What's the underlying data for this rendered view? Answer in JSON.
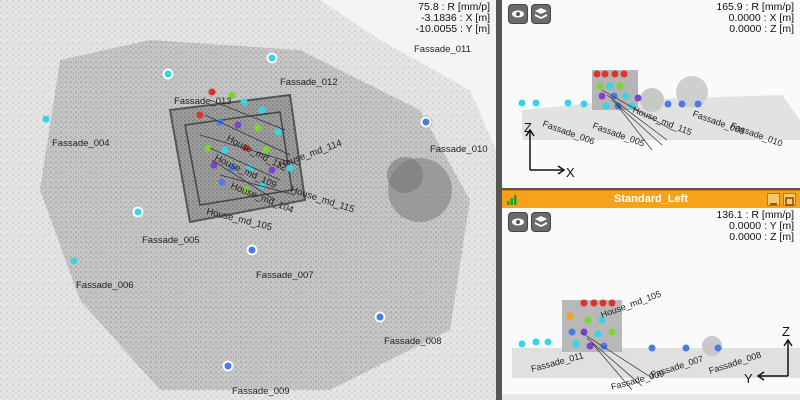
{
  "main_view": {
    "readout": [
      "75.8 : R [mm/p]",
      "-3.1836 : X [m]",
      "-10.0055 : Y [m]"
    ],
    "labels": [
      "Fassade_011",
      "Fassade_012",
      "Fassade_013",
      "Fassade_004",
      "Fassade_010",
      "Fassade_005",
      "Fassade_006",
      "Fassade_007",
      "Fassade_008",
      "Fassade_009",
      "House_md_112",
      "House_md_114",
      "House_md_115",
      "House_md_105",
      "House_md_104",
      "House_md_109"
    ]
  },
  "front_view": {
    "readout": [
      "165.9 : R [mm/p]",
      "0.0000 : X [m]",
      "0.0000 : Z [m]"
    ],
    "axis_vertical": "Z",
    "axis_horizontal": "X",
    "labels": [
      "Fassade_006",
      "Fassade_005",
      "Fassade_008",
      "Fassade_010",
      "House_md_115"
    ]
  },
  "left_view": {
    "title": "Standard_Left",
    "readout": [
      "136.1 : R [mm/p]",
      "0.0000 : Y [m]",
      "0.0000 : Z [m]"
    ],
    "axis_vertical": "Z",
    "axis_horizontal": "Y",
    "labels": [
      "House_md_105",
      "Fassade_011",
      "Fassade_008",
      "Fassade_007",
      "Fassade_009"
    ]
  },
  "colors": {
    "accent": "#f7a21b",
    "marker_cyan": "#35d4e6",
    "marker_blue": "#4a7be8",
    "marker_red": "#e03030",
    "marker_green": "#7bd630",
    "marker_purple": "#8040d0"
  },
  "icons": [
    "eye-icon",
    "layers-icon",
    "view-icon",
    "minimize-icon",
    "maximize-icon"
  ]
}
